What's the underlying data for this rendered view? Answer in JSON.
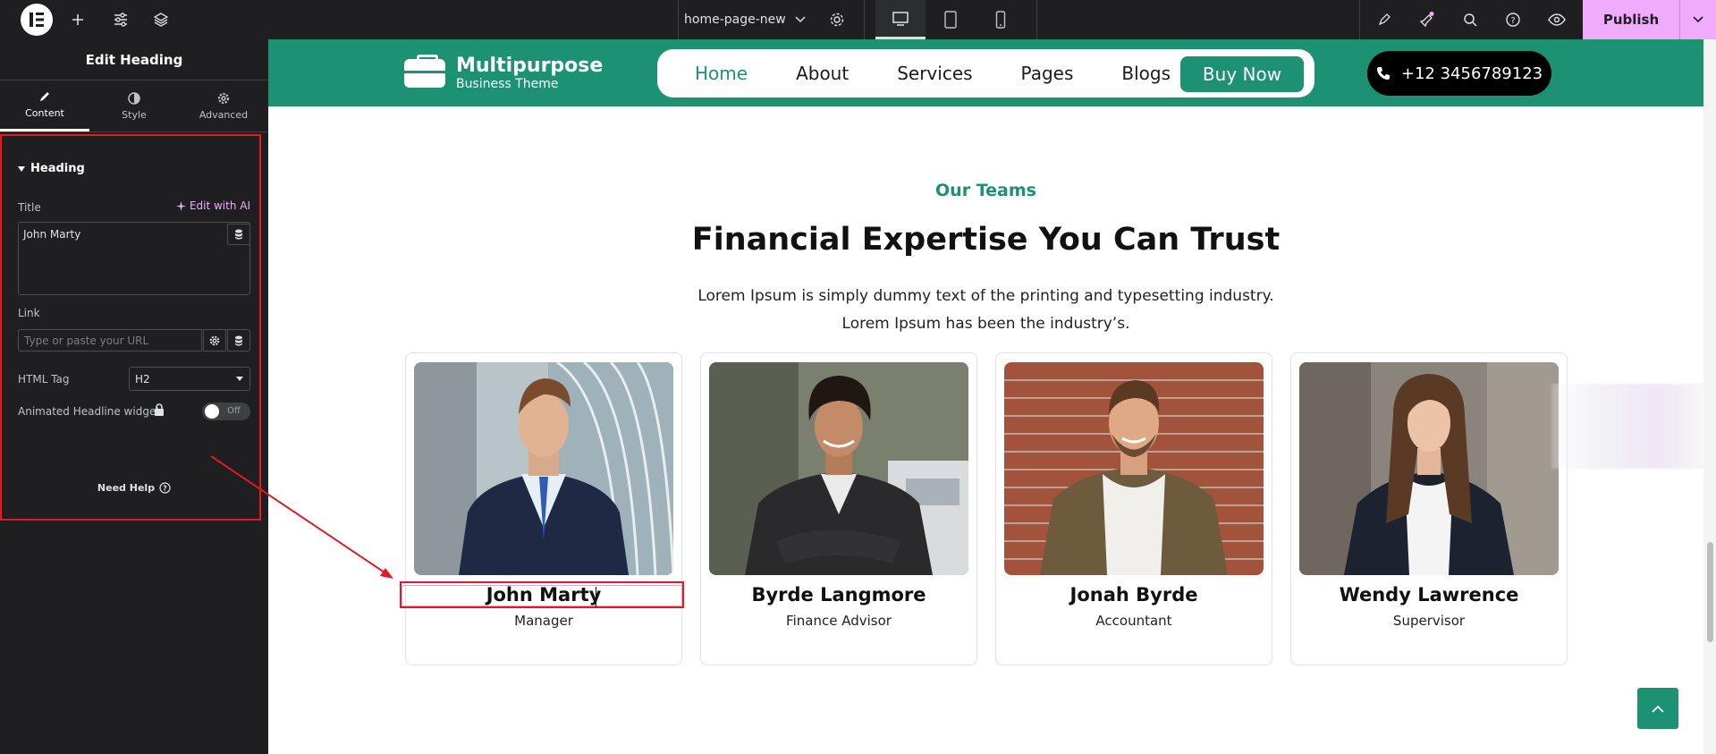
{
  "editor": {
    "page_name": "home-page-new",
    "publish_label": "Publish",
    "panel_title": "Edit Heading",
    "tabs": [
      {
        "label": "Content"
      },
      {
        "label": "Style"
      },
      {
        "label": "Advanced"
      }
    ],
    "section_label": "Heading",
    "title_label": "Title",
    "edit_with_ai": "Edit with AI",
    "title_value": "John Marty",
    "link_label": "Link",
    "link_placeholder": "Type or paste your URL",
    "html_tag_label": "HTML Tag",
    "html_tag_value": "H2",
    "animated_label": "Animated Headline widget",
    "toggle_label": "Off",
    "need_help": "Need Help"
  },
  "site": {
    "brand_name": "Multipurpose",
    "brand_sub": "Business Theme",
    "nav": [
      "Home",
      "About",
      "Services",
      "Pages",
      "Blogs"
    ],
    "buy_label": "Buy Now",
    "phone": "+12 3456789123",
    "eyebrow": "Our Teams",
    "headline": "Financial Expertise You Can Trust",
    "desc_line1": "Lorem Ipsum is simply dummy text of the printing and typesetting industry.",
    "desc_line2": "Lorem Ipsum has been the industry’s.",
    "team": [
      {
        "name": "John Marty",
        "role": "Manager"
      },
      {
        "name": "Byrde Langmore",
        "role": "Finance Advisor"
      },
      {
        "name": "Jonah Byrde",
        "role": "Accountant"
      },
      {
        "name": "Wendy Lawrence",
        "role": "Supervisor"
      }
    ]
  },
  "colors": {
    "accent": "#1d9272",
    "publish": "#f0abfc",
    "annotation": "#e01b24"
  }
}
